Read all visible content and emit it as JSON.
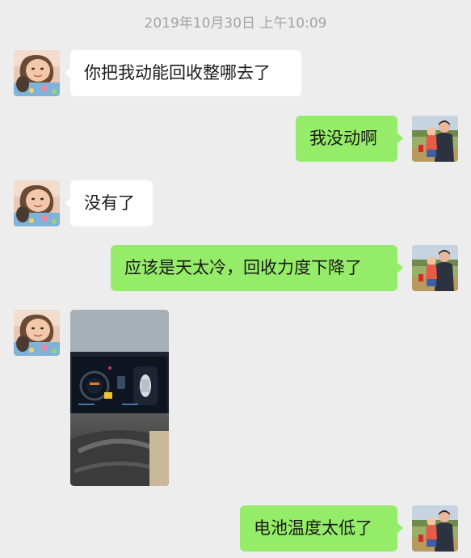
{
  "chat": {
    "timestamp": "2019年10月30日 上午10:09",
    "messages": [
      {
        "sender": "other",
        "text": "你把我动能回收整哪去了"
      },
      {
        "sender": "self",
        "text": "我没动啊"
      },
      {
        "sender": "other",
        "text": "没有了"
      },
      {
        "sender": "self",
        "text": "应该是天太冷，回收力度下降了"
      },
      {
        "sender": "other",
        "type": "image",
        "image": "car-dashboard-photo"
      },
      {
        "sender": "self",
        "text": "电池温度太低了"
      }
    ]
  },
  "icons": {
    "other_avatar": "girl-avatar",
    "self_avatar": "man-holding-child-avatar"
  },
  "colors": {
    "background": "#ededed",
    "incoming_bubble": "#ffffff",
    "outgoing_bubble": "#95ec69",
    "timestamp_text": "#a3a3a3"
  }
}
